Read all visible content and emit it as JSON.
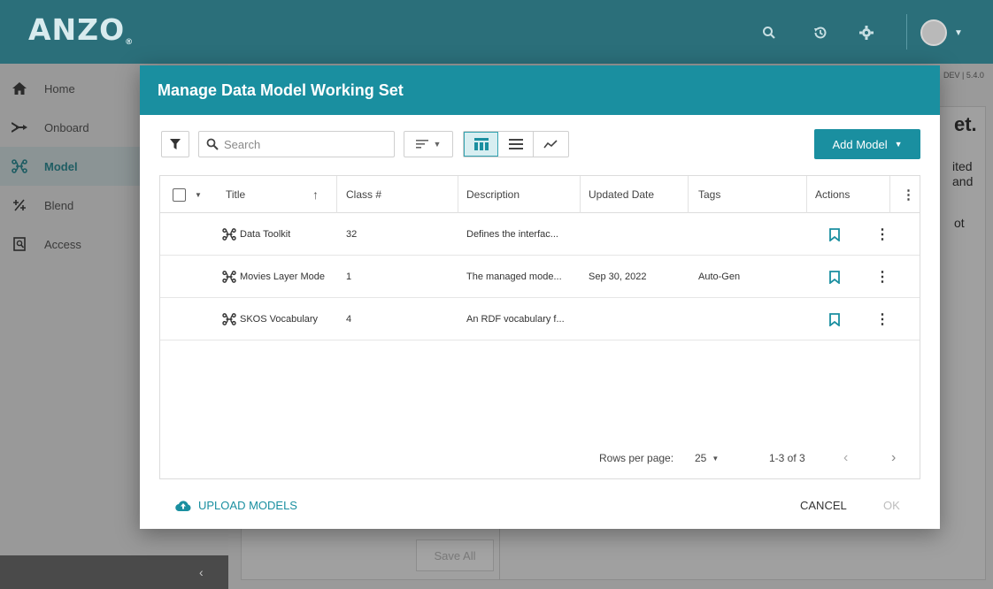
{
  "app": {
    "logo": "ANZO",
    "version": "DEV | 5.4.0"
  },
  "topbar_icons": [
    "search-icon",
    "history-icon",
    "gear-icon",
    "avatar",
    "chevron-down-icon"
  ],
  "sidebar": {
    "items": [
      {
        "label": "Home",
        "icon": "home-icon",
        "active": false
      },
      {
        "label": "Onboard",
        "icon": "onboard-arrow-icon",
        "active": false
      },
      {
        "label": "Model",
        "icon": "model-graph-icon",
        "active": true
      },
      {
        "label": "Blend",
        "icon": "blend-icon",
        "active": false
      },
      {
        "label": "Access",
        "icon": "access-icon",
        "active": false
      }
    ]
  },
  "background": {
    "heading_fragment": "et.",
    "text_fragment_1": "ited",
    "text_fragment_2": "and",
    "text_fragment_3": "ot",
    "save_all_label": "Save All"
  },
  "modal": {
    "title": "Manage Data Model Working Set",
    "search_placeholder": "Search",
    "add_model_label": "Add Model",
    "columns": {
      "title": "Title",
      "class_count": "Class #",
      "description": "Description",
      "updated_date": "Updated Date",
      "tags": "Tags",
      "actions": "Actions"
    },
    "rows": [
      {
        "title": "Data Toolkit",
        "class_count": "32",
        "description": "Defines the interfac...",
        "updated_date": "",
        "tags": ""
      },
      {
        "title": "Movies Layer Mode",
        "class_count": "1",
        "description": "The managed mode...",
        "updated_date": "Sep 30, 2022",
        "tags": "Auto-Gen"
      },
      {
        "title": "SKOS Vocabulary",
        "class_count": "4",
        "description": "An RDF vocabulary f...",
        "updated_date": "",
        "tags": ""
      }
    ],
    "pagination": {
      "rows_per_page_label": "Rows per page:",
      "rows_per_page_value": "25",
      "range": "1-3 of 3"
    },
    "upload_label": "UPLOAD MODELS",
    "cancel_label": "CANCEL",
    "ok_label": "OK"
  },
  "colors": {
    "topbar": "#2b6f7a",
    "accent": "#1a8fa0",
    "overlay_gray": "#999999"
  }
}
